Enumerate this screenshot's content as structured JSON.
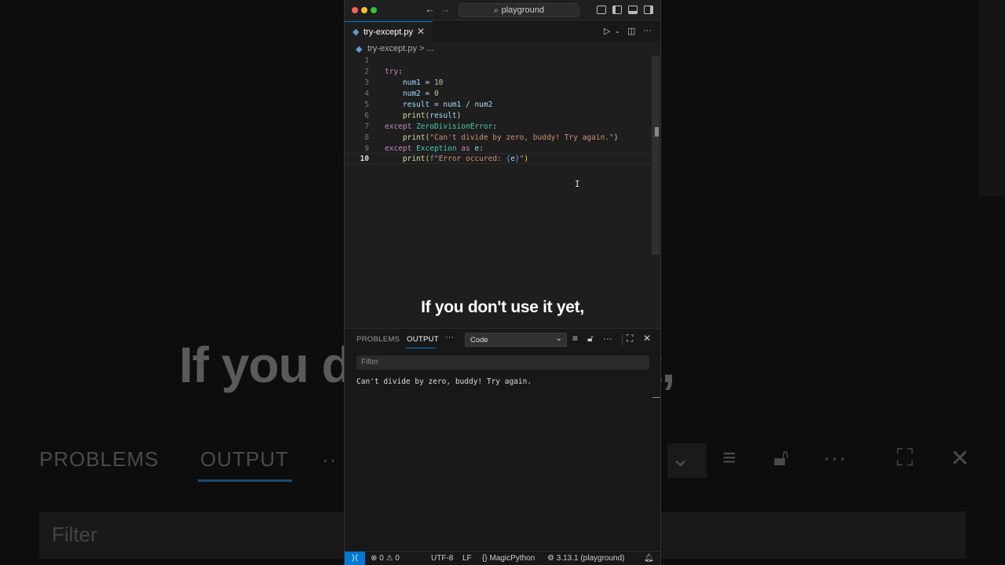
{
  "background": {
    "caption": "If you don't use it yet,",
    "tabs": {
      "problems": "PROBLEMS",
      "output": "OUTPUT",
      "more": "··"
    },
    "filter": "Filter"
  },
  "window": {
    "title": "playground",
    "tab": {
      "filename": "try-except.py",
      "close": "✕"
    },
    "breadcrumb": {
      "file": "try-except.py",
      "separator": ">",
      "more": "..."
    }
  },
  "editor": {
    "lines": [
      {
        "number": "1"
      },
      {
        "number": "2",
        "tokens": [
          [
            "kw",
            "try"
          ],
          [
            "",
            "…"
          ]
        ]
      },
      {
        "number": "3"
      },
      {
        "number": "4"
      },
      {
        "number": "5"
      },
      {
        "number": "6"
      },
      {
        "number": "7"
      },
      {
        "number": "8"
      },
      {
        "number": "9"
      },
      {
        "number": "10"
      }
    ],
    "t": {
      "l2_kw": "try",
      "l2_p": ":",
      "l3_v": "num1",
      "l3_op": " = ",
      "l3_n": "10",
      "l4_v": "num2",
      "l4_op": " = ",
      "l4_n": "0",
      "l5_v1": "result",
      "l5_op1": " = ",
      "l5_v2": "num1",
      "l5_op2": " / ",
      "l5_v3": "num2",
      "l6_f": "print",
      "l6_p1": "(",
      "l6_v": "result",
      "l6_p2": ")",
      "l7_kw": "except",
      "l7_c": "ZeroDivisionError",
      "l7_p": ":",
      "l8_f": "print",
      "l8_p1": "(",
      "l8_s": "\"Can't divide by zero, buddy! Try again.\"",
      "l8_p2": ")",
      "l9_kw1": "except",
      "l9_c": "Exception",
      "l9_kw2": "as",
      "l9_v": "e",
      "l9_p": ":",
      "l10_f": "print",
      "l10_p1": "(",
      "l10_fp": "f",
      "l10_s": "\"Error occured: ",
      "l10_b1": "{",
      "l10_v": "e",
      "l10_b2": "}",
      "l10_s2": "\"",
      "l10_p2": ")"
    }
  },
  "caption": "If you don't use it yet,",
  "panel": {
    "tabs": {
      "problems": "PROBLEMS",
      "output": "OUTPUT"
    },
    "more": "···",
    "channel": "Code",
    "filter_placeholder": "Filter",
    "output_text": "Can't divide by zero, buddy! Try again."
  },
  "statusbar": {
    "remote": "⟩⟨",
    "errors": "0",
    "warnings": "0",
    "encoding": "UTF-8",
    "eol": "LF",
    "language": "MagicPython",
    "interpreter": "3.13.1 (playground)"
  },
  "colors": {
    "accent": "#0078d4",
    "editor_bg": "#1e1e1e",
    "panel_bg": "#181818"
  }
}
